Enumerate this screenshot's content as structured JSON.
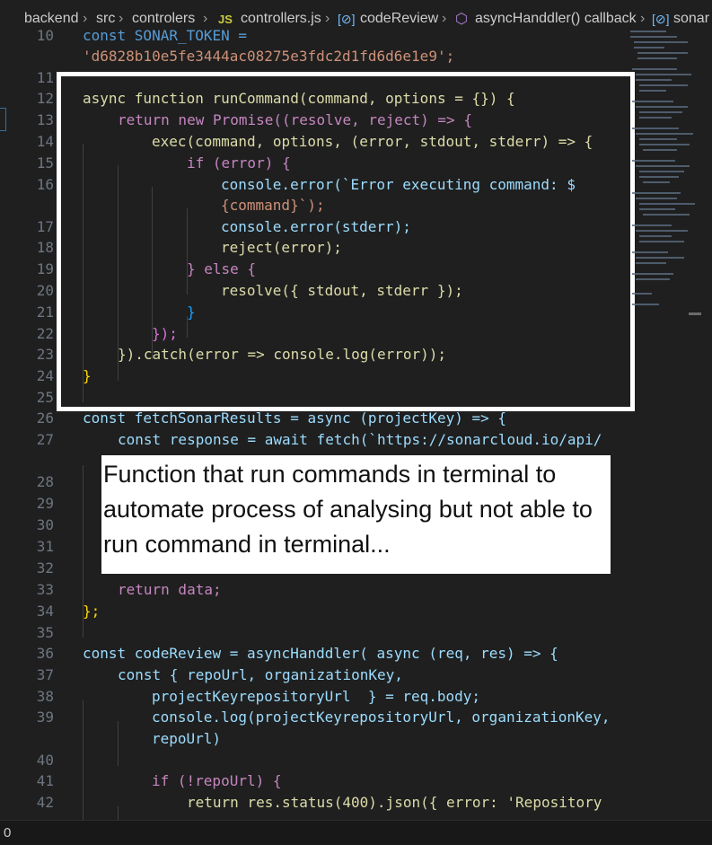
{
  "breadcrumb": {
    "items": [
      "backend",
      "src",
      "controlers",
      "controllers.js",
      "codeReview",
      "asyncHanddler() callback",
      "sonar"
    ],
    "icons": [
      "js-file-icon",
      "variable-symbol-icon",
      "method-cube-icon",
      "variable-symbol-icon"
    ]
  },
  "editor": {
    "line_numbers": [
      "10",
      "11",
      "12",
      "13",
      "14",
      "15",
      "16",
      "17",
      "18",
      "19",
      "20",
      "21",
      "22",
      "23",
      "24",
      "25",
      "26",
      "27",
      "28",
      "29",
      "30",
      "31",
      "32",
      "33",
      "34",
      "35",
      "36",
      "37",
      "38",
      "39",
      "40",
      "41",
      "42"
    ],
    "lines": [
      "const SONAR_TOKEN =",
      "'d6828b10e5fe3444ac08275e3fdc2d1fd6d6e1e9';",
      "async function runCommand(command, options = {}) {",
      "return new Promise((resolve, reject) => {",
      "exec(command, options, (error, stdout, stderr) => {",
      "if (error) {",
      "console.error(`Error executing command: $",
      "{command}`);",
      "console.error(stderr);",
      "reject(error);",
      "} else {",
      "resolve({ stdout, stderr });",
      "}",
      "});",
      "}).catch(error => console.log(error));",
      "}",
      "const fetchSonarResults = async (projectKey) => {",
      "const response = await fetch(`https://sonarcloud.io/api/",
      "return data;",
      "};",
      "const codeReview = asyncHanddler( async (req, res) => {",
      "const { repoUrl, organizationKey,",
      "projectKeyrepositoryUrl  } = req.body;",
      "console.log(projectKeyrepositoryUrl, organizationKey,",
      "repoUrl)",
      "if (!repoUrl) {",
      "return res.status(400).json({ error: 'Repository"
    ]
  },
  "annotation": {
    "text": "Function that run commands in terminal to automate process of analysing but not able to run command in terminal..."
  },
  "status_bar": {
    "left_text": "0"
  },
  "colors": {
    "background": "#1f1f1f",
    "keyword": "#569cd6",
    "control": "#c586c0",
    "function": "#dcdcaa",
    "variable": "#9cdcfe",
    "class": "#4ec9b0",
    "string": "#ce9178",
    "line_number": "#6e7681",
    "highlight_border": "#ffffff"
  }
}
